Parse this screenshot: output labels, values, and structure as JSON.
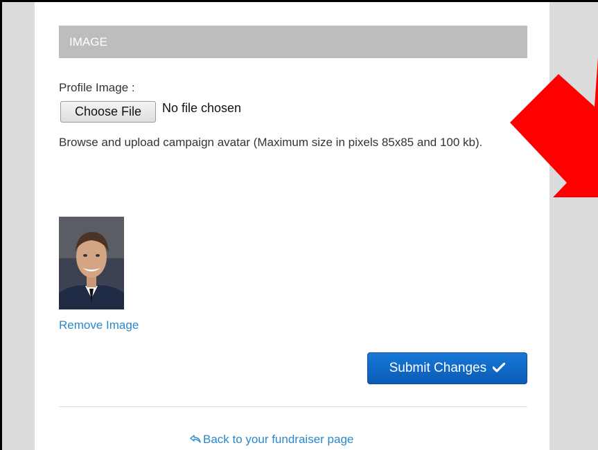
{
  "section": {
    "title": "IMAGE"
  },
  "profile": {
    "label": "Profile Image :",
    "choose_button": "Choose File",
    "no_file_text": "No file chosen",
    "help_text": "Browse and upload campaign avatar (Maximum size in pixels 85x85 and 100 kb).",
    "remove_link": "Remove Image"
  },
  "actions": {
    "submit_label": "Submit Changes",
    "submit_icon": "checkmark-icon",
    "back_link": "Back to your fundraiser page",
    "back_icon": "share-arrow-icon"
  },
  "colors": {
    "header_bg": "#bdbdbd",
    "link": "#2a88c9",
    "submit_bg": "#0b5bb5",
    "annotation_arrow": "#ff0000"
  }
}
